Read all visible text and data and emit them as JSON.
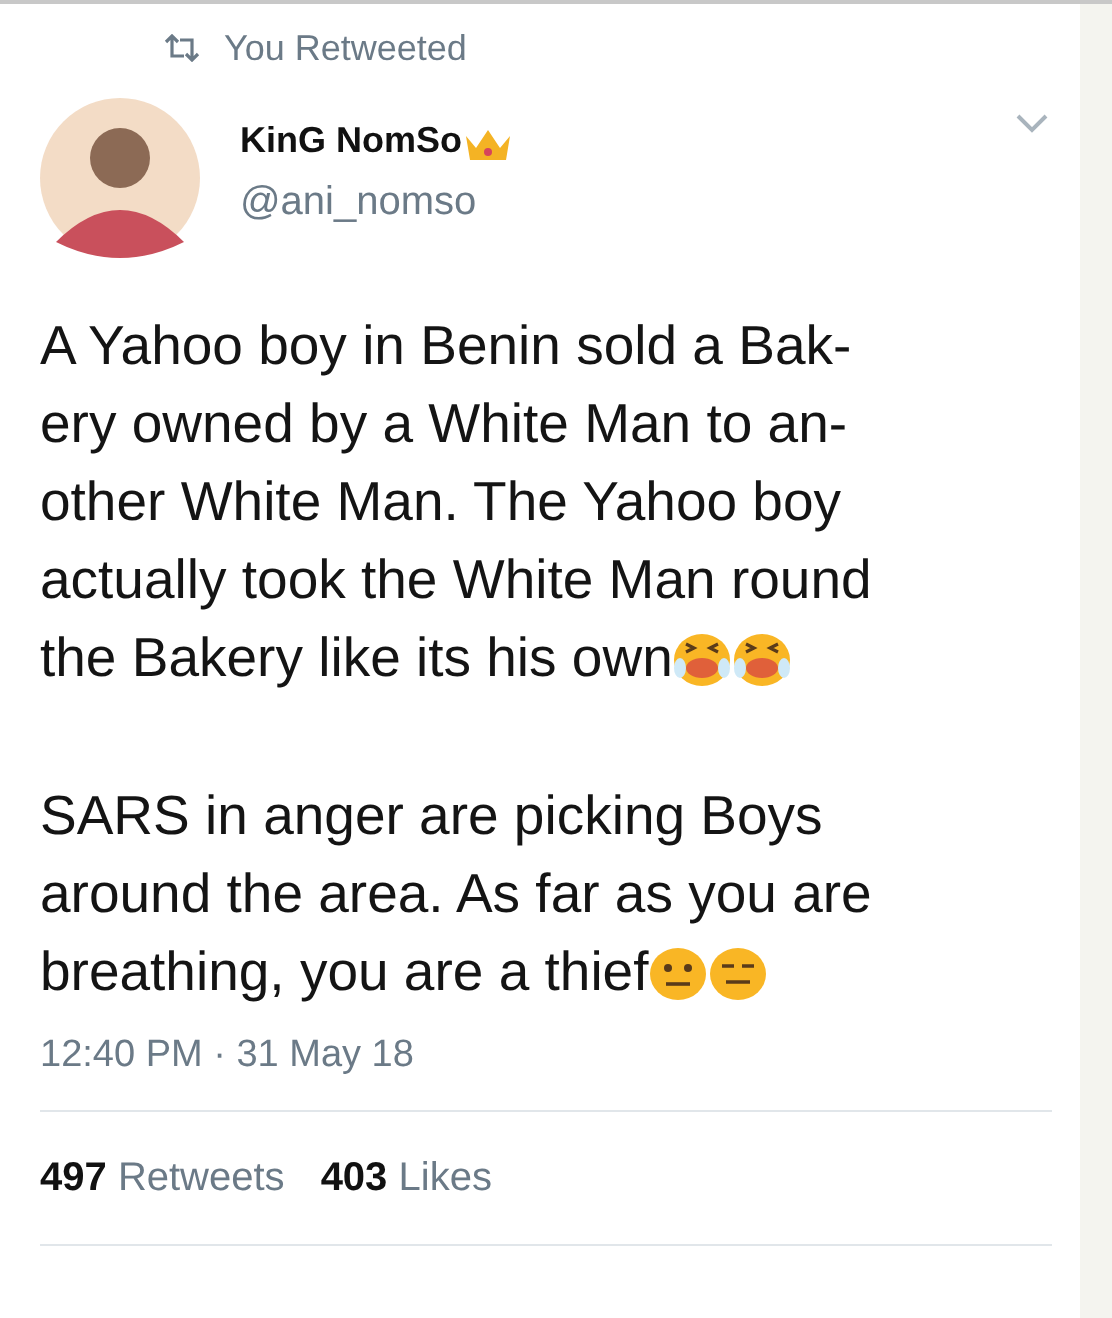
{
  "retweet_notice": "You Retweeted",
  "author": {
    "name": "KinG NomSo",
    "handle": "@ani_nomso"
  },
  "paragraphs": [
    {
      "lines": [
        "A Yahoo boy in Benin sold a Bak-",
        "ery owned by a White Man to an-",
        "other White Man. The Yahoo boy",
        "actually took the White Man round",
        "the Bakery like its his own"
      ],
      "emojis": [
        {
          "kind": "crying"
        },
        {
          "kind": "crying"
        }
      ]
    },
    {
      "lines": [
        "SARS in anger are picking Boys",
        "around the area. As far as you are",
        "breathing, you are a thief"
      ],
      "emojis": [
        {
          "kind": "neutral"
        },
        {
          "kind": "expressionless"
        }
      ]
    }
  ],
  "timestamp": "12:40 PM · 31 May 18",
  "stats": [
    {
      "count": "497",
      "label": "Retweets"
    },
    {
      "count": "403",
      "label": "Likes"
    }
  ]
}
